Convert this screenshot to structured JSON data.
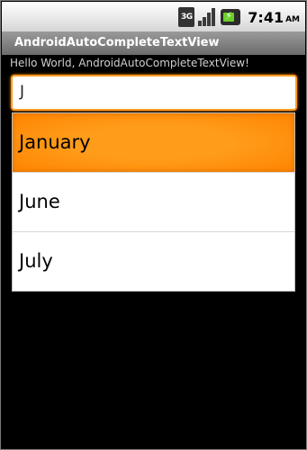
{
  "status_bar": {
    "network_label": "3G",
    "time": "7:41",
    "ampm": "AM",
    "icons": [
      "3g-icon",
      "signal-icon",
      "battery-charging-icon"
    ]
  },
  "app": {
    "title": "AndroidAutoCompleteTextView",
    "hello_text": "Hello World, AndroidAutoCompleteTextView!"
  },
  "input": {
    "value": "J"
  },
  "suggestions": [
    {
      "label": "January",
      "selected": true
    },
    {
      "label": "June",
      "selected": false
    },
    {
      "label": "July",
      "selected": false
    }
  ],
  "colors": {
    "accent": "#ff8c00",
    "titlebar": "#7a7a7a"
  }
}
